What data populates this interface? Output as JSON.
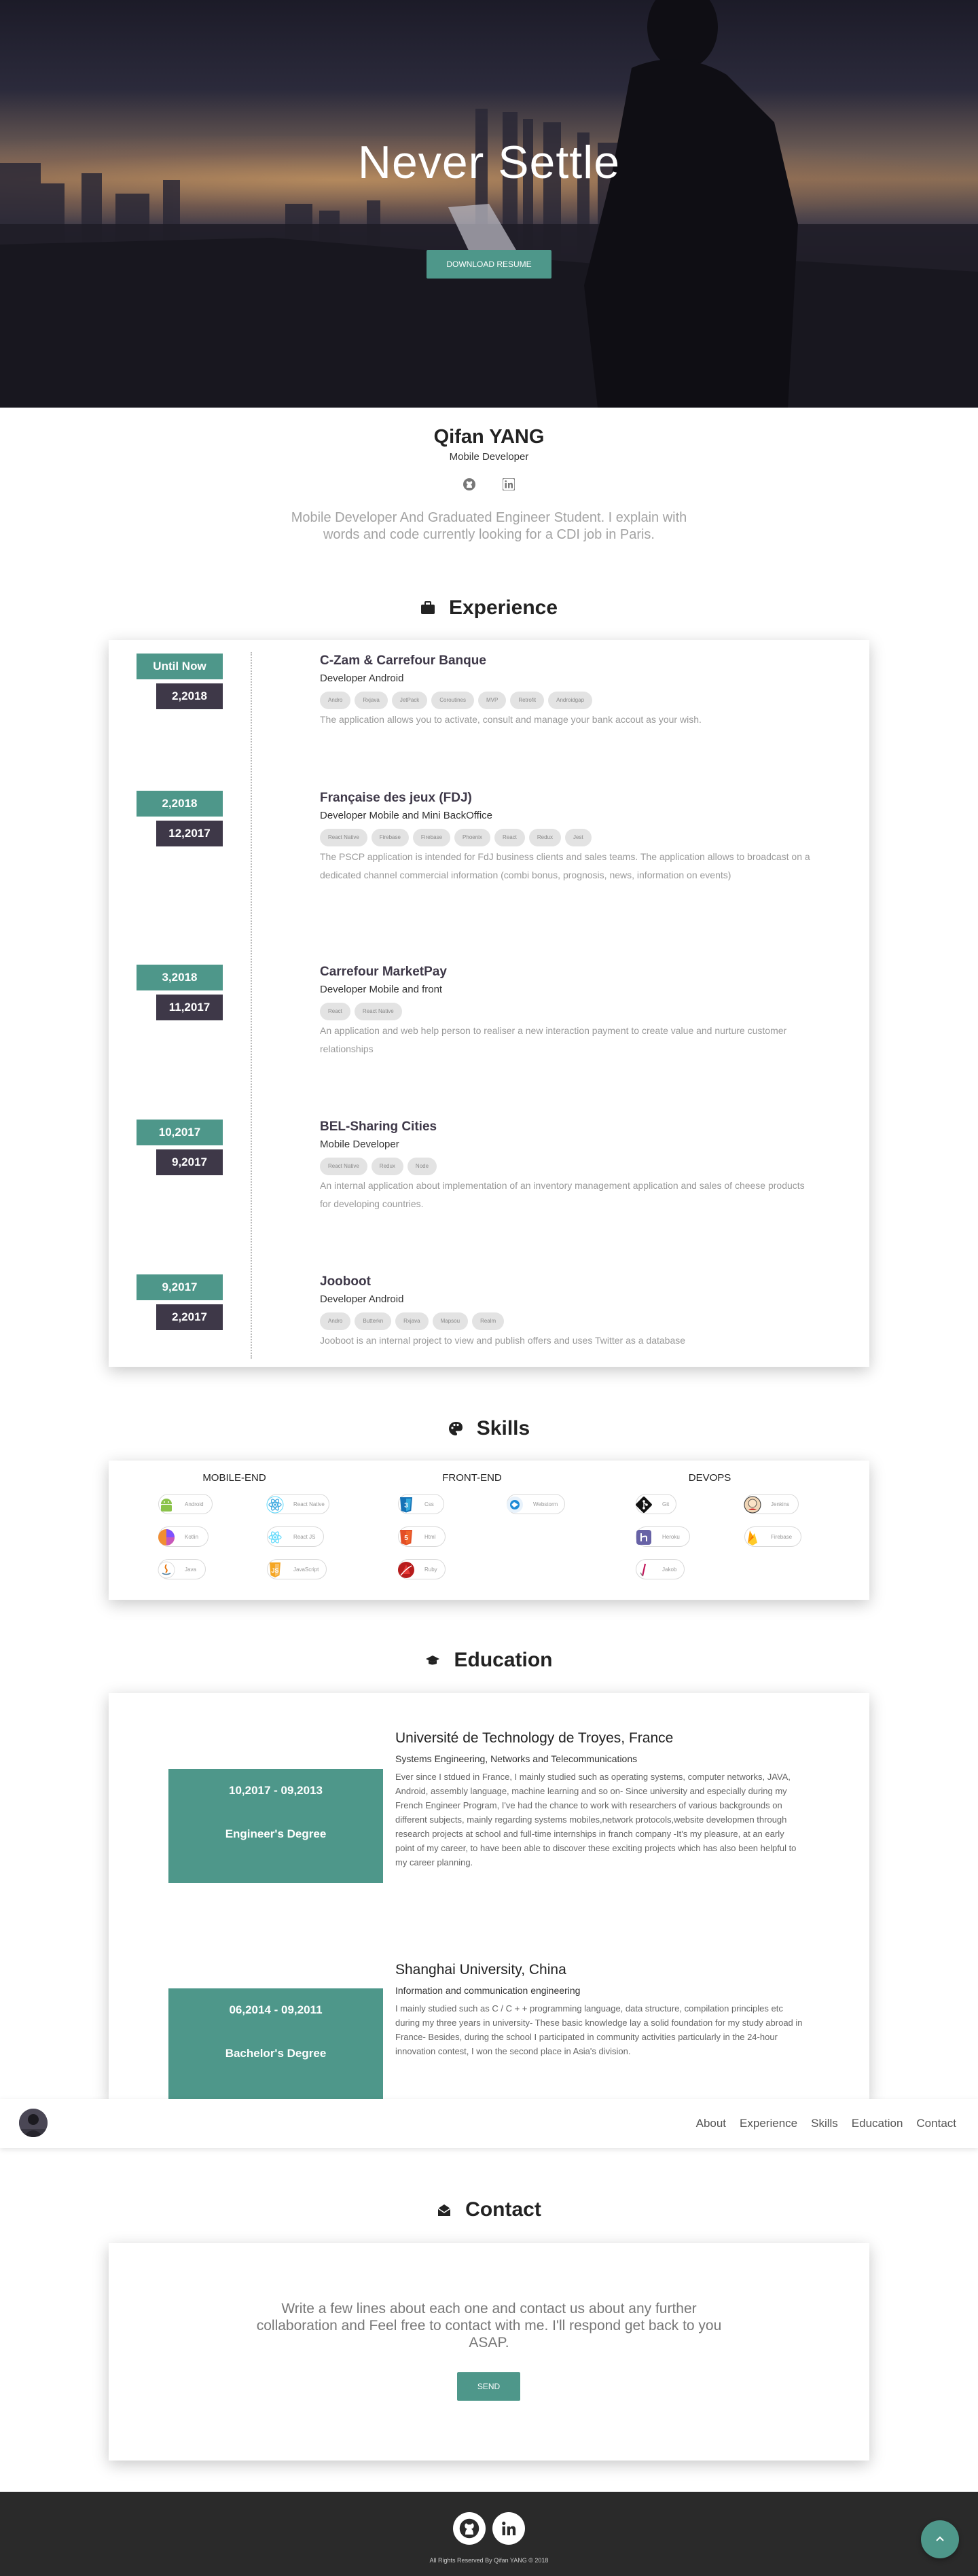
{
  "hero": {
    "title": "Never Settle",
    "button": "DOWNLOAD RESUME"
  },
  "profile": {
    "name": "Qifan YANG",
    "role": "Mobile Developer",
    "bio": "Mobile Developer And Graduated Engineer Student. I explain with words and code currently looking for a CDI job in Paris."
  },
  "experience": {
    "title": "Experience",
    "items": [
      {
        "date_start_label": "Until Now",
        "date_end_label": "2,2018",
        "company": "C-Zam & Carrefour Banque",
        "role": "Developer Android",
        "tags": [
          "Andro",
          "Rxjava",
          "JetPack",
          "Coroutines",
          "MVP",
          "Retrofit",
          "Androidgap"
        ],
        "description": "The application allows you to activate, consult and manage your bank accout as your wish."
      },
      {
        "date_start_label": "2,2018",
        "date_end_label": "12,2017",
        "company": "Française des jeux (FDJ)",
        "role": "Developer Mobile and Mini BackOffice",
        "tags": [
          "React Native",
          "Firebase",
          "Firebase",
          "Phoenix",
          "React",
          "Redux",
          "Jest"
        ],
        "description": "The PSCP application is intended for FdJ business clients and sales teams. The application allows to broadcast on a dedicated channel commercial information (combi bonus, prognosis, news, information on events)"
      },
      {
        "date_start_label": "3,2018",
        "date_end_label": "11,2017",
        "company": "Carrefour MarketPay",
        "role": "Developer Mobile and front",
        "tags": [
          "React",
          "React Native"
        ],
        "description": "An application and web help person to realiser a new interaction payment to create value and nurture customer relationships"
      },
      {
        "date_start_label": "10,2017",
        "date_end_label": "9,2017",
        "company": "BEL-Sharing Cities",
        "role": "Mobile Developer",
        "tags": [
          "React Native",
          "Redux",
          "Node"
        ],
        "description": "An internal application about implementation of an inventory management application and sales of cheese products for developing countries."
      },
      {
        "date_start_label": "9,2017",
        "date_end_label": "2,2017",
        "company": "Jooboot",
        "role": "Developer Android",
        "tags": [
          "Andro",
          "Butterkn",
          "Rxjava",
          "Mapsou",
          "Realm"
        ],
        "description": "Jooboot is an internal project to view and publish offers and uses Twitter as a database"
      }
    ]
  },
  "skills": {
    "title": "Skills",
    "columns": [
      {
        "title": "MOBILE-END",
        "items": [
          {
            "name": "Android",
            "icon": "android-icon"
          },
          {
            "name": "React Native",
            "icon": "react-icon"
          },
          {
            "name": "Kotlin",
            "icon": "kotlin-icon"
          },
          {
            "name": "React JS",
            "icon": "react-icon"
          },
          {
            "name": "Java",
            "icon": "java-icon"
          },
          {
            "name": "JavaScript",
            "icon": "javascript-icon"
          }
        ]
      },
      {
        "title": "FRONT-END",
        "items": [
          {
            "name": "Css",
            "icon": "css3-icon"
          },
          {
            "name": "Webstorm",
            "icon": "webstorm-icon"
          },
          {
            "name": "Html",
            "icon": "html5-icon"
          },
          {
            "name": "Ruby",
            "icon": "ruby-icon"
          }
        ]
      },
      {
        "title": "DEVOPS",
        "items": [
          {
            "name": "Git",
            "icon": "git-icon"
          },
          {
            "name": "Jenkins",
            "icon": "jenkins-icon"
          },
          {
            "name": "Heroku",
            "icon": "heroku-icon"
          },
          {
            "name": "Firebase",
            "icon": "firebase-icon"
          },
          {
            "name": "Jakob",
            "icon": "jakob-icon"
          }
        ]
      }
    ]
  },
  "education": {
    "title": "Education",
    "items": [
      {
        "dates": "10,2017 - 09,2013",
        "degree": "Engineer's Degree",
        "school": "Université de Technology de Troyes, France",
        "field": "Systems Engineering, Networks and Telecommunications",
        "description": "Ever since I stdued in France, I mainly studied such as operating systems, computer networks, JAVA, Android, assembly language, machine learning and so on- Since university and especially during my French Engineer Program, I've had the chance to work with researchers of various backgrounds on different subjects, mainly regarding systems mobiles,network protocols,website developmen through research projects at school and full-time internships in franch company -It's my pleasure, at an early point of my career, to have been able to discover these exciting projects which has also been helpful to my career planning."
      },
      {
        "dates": "06,2014 - 09,2011",
        "degree": "Bachelor's Degree",
        "school": "Shanghai University, China",
        "field": "Information and communication engineering",
        "description": "I mainly studied such as C / C + + programming language, data structure, compilation principles etc during my three years in university- These basic knowledge lay a solid foundation for my study abroad in France- Besides, during the school I participated in community activities particularly in the 24-hour innovation contest, I won the second place in Asia's division."
      }
    ]
  },
  "nav": {
    "links": [
      "About",
      "Experience",
      "Skills",
      "Education",
      "Contact"
    ]
  },
  "contact": {
    "title": "Contact",
    "text": "Write a few lines about each one and contact us about any further collaboration and Feel free to contact with me. I'll respond get back to you ASAP.",
    "button": "SEND"
  },
  "footer": {
    "copyright": "All Rights Reserved By Qifan YANG © 2018"
  },
  "colors": {
    "accent": "#4e978a",
    "dark_date": "#3e3848",
    "footer": "#2a2a2a"
  }
}
